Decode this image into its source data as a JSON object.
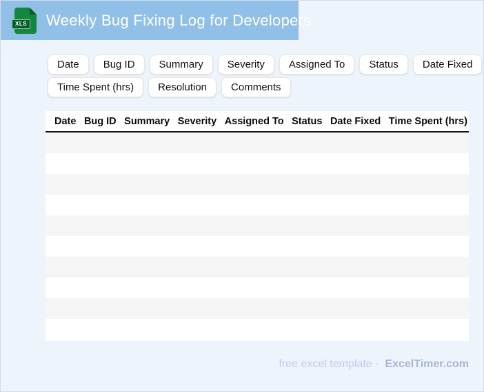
{
  "header": {
    "title": "Weekly Bug Fixing Log for Developers",
    "file_badge": "XLS"
  },
  "chips_row1": [
    "Date",
    "Bug ID",
    "Summary",
    "Severity",
    "Assigned To",
    "Status",
    "Date Fixed"
  ],
  "chips_row2": [
    "Time Spent (hrs)",
    "Resolution",
    "Comments"
  ],
  "table": {
    "columns": [
      "Date",
      "Bug ID",
      "Summary",
      "Severity",
      "Assigned To",
      "Status",
      "Date Fixed",
      "Time Spent (hrs)"
    ],
    "row_count": 10
  },
  "footer": {
    "text": "free excel template -",
    "brand": "ExcelTimer.com"
  },
  "colors": {
    "banner_blue": "#90bfe8",
    "page_background": "#eef4fc",
    "icon_green": "#12873d",
    "icon_dark_green": "#0a5c2a",
    "row_alt_gray": "#f5f5f5",
    "header_rule_black": "#141414",
    "footer_light": "#bfcaf0",
    "footer_brand": "#a9b4d8"
  }
}
